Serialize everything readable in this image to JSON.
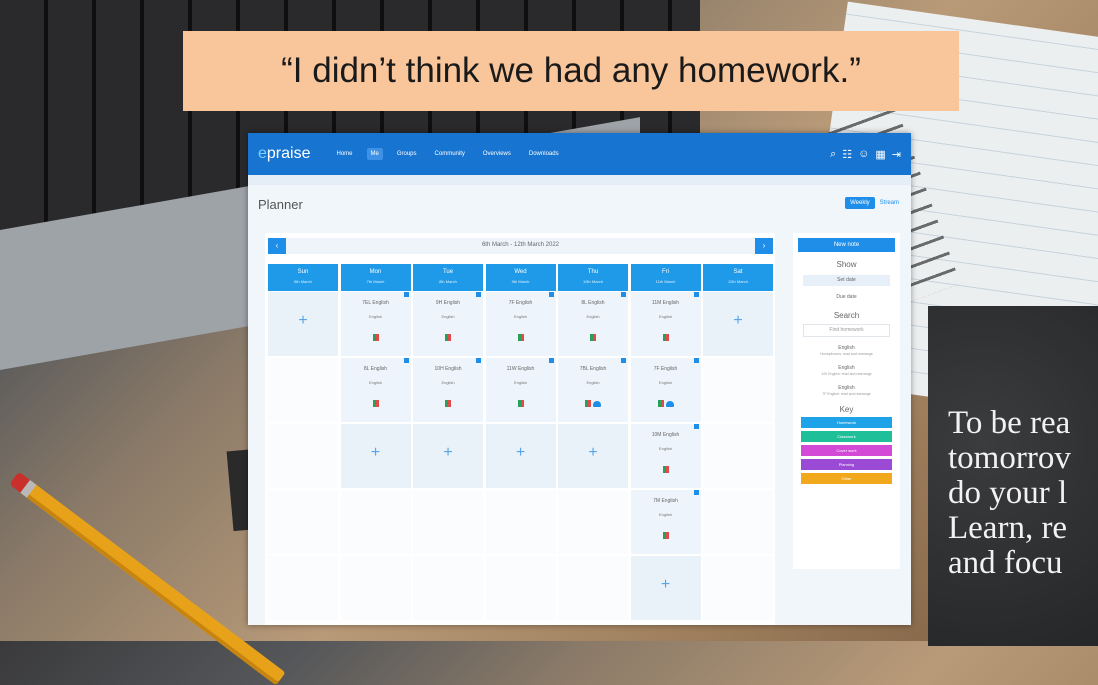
{
  "quote": "“I didn’t think we had any homework.”",
  "blackboard": {
    "lines": [
      "To be rea",
      "tomorrov",
      "do your l",
      "Learn, re",
      "and focu"
    ]
  },
  "app": {
    "logo_prefix": "e",
    "logo_name": "praise",
    "nav": [
      "Home",
      "Me",
      "Groups",
      "Community",
      "Overviews",
      "Downloads"
    ],
    "active_nav": "Me",
    "top_icons": [
      "search-icon",
      "grid-icon",
      "user-icon",
      "calendar-icon",
      "logout-icon"
    ],
    "page_title": "Planner",
    "view_buttons": {
      "weekly": "Weekly",
      "stream": "Stream"
    },
    "week_range": "6th March - 12th March 2022",
    "prev_label": "‹",
    "next_label": "›",
    "plus": "+",
    "days": [
      {
        "name": "Sun",
        "date": "6th March"
      },
      {
        "name": "Mon",
        "date": "7th March"
      },
      {
        "name": "Tue",
        "date": "8th March"
      },
      {
        "name": "Wed",
        "date": "9th March"
      },
      {
        "name": "Thu",
        "date": "10th March"
      },
      {
        "name": "Fri",
        "date": "11th March"
      },
      {
        "name": "Sat",
        "date": "12th March"
      }
    ],
    "homework": [
      {
        "title": "7EL English",
        "subject": "English",
        "day": 1,
        "row": 0
      },
      {
        "title": "9H English",
        "subject": "English",
        "day": 2,
        "row": 0
      },
      {
        "title": "7F English",
        "subject": "English",
        "day": 3,
        "row": 0
      },
      {
        "title": "8L English",
        "subject": "English",
        "day": 4,
        "row": 0
      },
      {
        "title": "11M English",
        "subject": "English",
        "day": 5,
        "row": 0
      },
      {
        "title": "8L English",
        "subject": "English",
        "day": 1,
        "row": 1
      },
      {
        "title": "10H English",
        "subject": "English",
        "day": 2,
        "row": 1
      },
      {
        "title": "11W English",
        "subject": "English",
        "day": 3,
        "row": 1
      },
      {
        "title": "7BL English",
        "subject": "English",
        "day": 4,
        "row": 1,
        "cloud": true
      },
      {
        "title": "7F English",
        "subject": "English",
        "day": 5,
        "row": 1,
        "cloud": true
      },
      {
        "title": "10M English",
        "subject": "English",
        "day": 5,
        "row": 2
      },
      {
        "title": "7M English",
        "subject": "English",
        "day": 5,
        "row": 3
      }
    ],
    "plus_cells": [
      {
        "day": 0,
        "row": 0
      },
      {
        "day": 6,
        "row": 0
      },
      {
        "day": 1,
        "row": 2
      },
      {
        "day": 2,
        "row": 2
      },
      {
        "day": 3,
        "row": 2
      },
      {
        "day": 4,
        "row": 2
      },
      {
        "day": 5,
        "row": 4
      }
    ],
    "sidebar": {
      "new_note": "New note",
      "show_heading": "Show",
      "set_date": "Set date",
      "due_date": "Due date",
      "search_heading": "Search",
      "find_placeholder": "Find homework",
      "filters": [
        {
          "subject": "English",
          "detail": "Homophones: read and rearrange"
        },
        {
          "subject": "English",
          "detail": "100 English: read and rearrange"
        },
        {
          "subject": "English",
          "detail": "7F English: read and rearrange"
        }
      ],
      "key_heading": "Key",
      "key": [
        {
          "label": "Homework",
          "color": "#1fa3e8"
        },
        {
          "label": "Classwork",
          "color": "#1fbf9a"
        },
        {
          "label": "Cover work",
          "color": "#d34ad6"
        },
        {
          "label": "Planning",
          "color": "#9b4ad6"
        },
        {
          "label": "Other",
          "color": "#f2a81d"
        }
      ]
    }
  }
}
